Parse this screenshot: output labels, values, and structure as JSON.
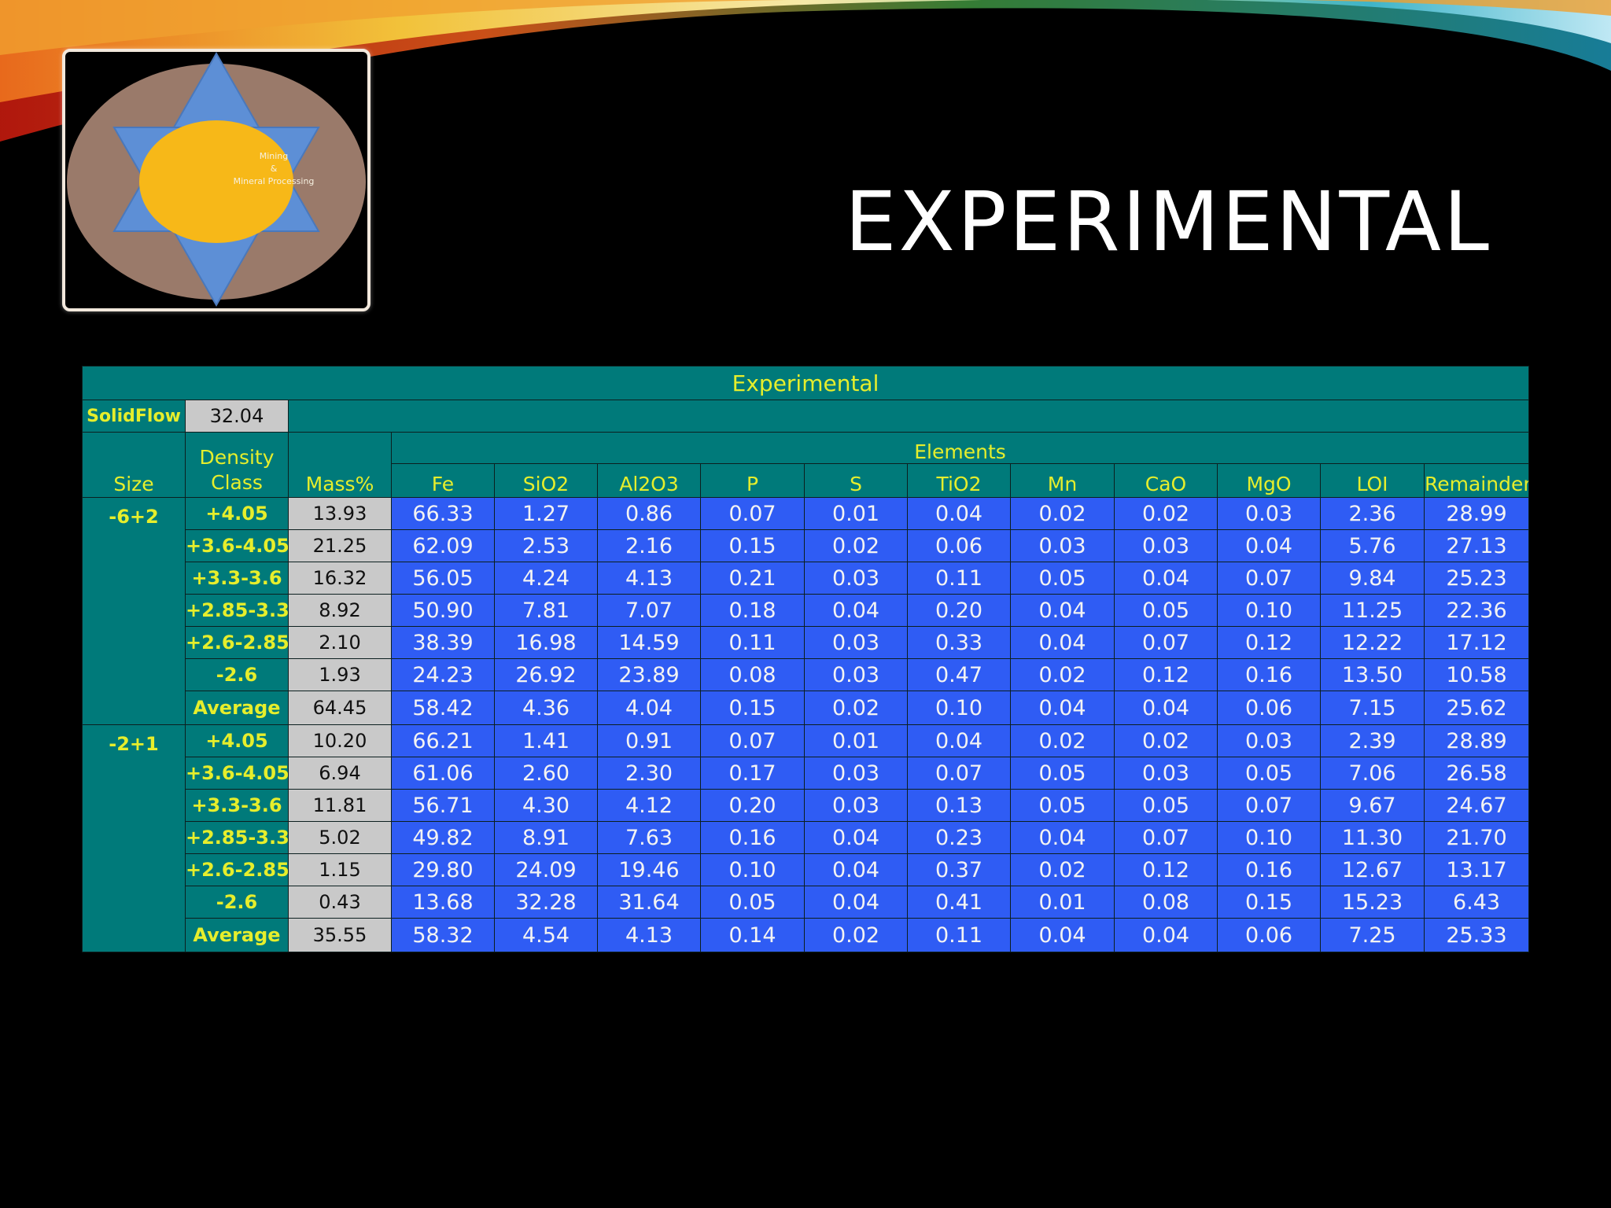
{
  "slide": {
    "title": "EXPERIMENTAL"
  },
  "logo": {
    "text_line1": "Mining",
    "text_line2": "&",
    "text_line3": "Mineral Processing"
  },
  "colors": {
    "teal": "#007a7a",
    "header_text": "#e6ee2c",
    "blue_cells": "#2f5cf4",
    "mass_cells": "#c9c9c9"
  },
  "table": {
    "title": "Experimental",
    "solid_flow_label": "SolidFlow",
    "solid_flow_value": "32.04",
    "headers": {
      "size": "Size",
      "density_line1": "Density",
      "density_line2": "Class",
      "mass": "Mass%",
      "elements": "Elements",
      "columns": [
        "Fe",
        "SiO2",
        "Al2O3",
        "P",
        "S",
        "TiO2",
        "Mn",
        "CaO",
        "MgO",
        "LOI",
        "Remainder"
      ]
    },
    "groups": [
      {
        "size": "-6+2",
        "rows": [
          {
            "density": "+4.05",
            "mass": "13.93",
            "values": [
              "66.33",
              "1.27",
              "0.86",
              "0.07",
              "0.01",
              "0.04",
              "0.02",
              "0.02",
              "0.03",
              "2.36",
              "28.99"
            ]
          },
          {
            "density": "+3.6-4.05",
            "mass": "21.25",
            "values": [
              "62.09",
              "2.53",
              "2.16",
              "0.15",
              "0.02",
              "0.06",
              "0.03",
              "0.03",
              "0.04",
              "5.76",
              "27.13"
            ]
          },
          {
            "density": "+3.3-3.6",
            "mass": "16.32",
            "values": [
              "56.05",
              "4.24",
              "4.13",
              "0.21",
              "0.03",
              "0.11",
              "0.05",
              "0.04",
              "0.07",
              "9.84",
              "25.23"
            ]
          },
          {
            "density": "+2.85-3.3",
            "mass": "8.92",
            "values": [
              "50.90",
              "7.81",
              "7.07",
              "0.18",
              "0.04",
              "0.20",
              "0.04",
              "0.05",
              "0.10",
              "11.25",
              "22.36"
            ]
          },
          {
            "density": "+2.6-2.85",
            "mass": "2.10",
            "values": [
              "38.39",
              "16.98",
              "14.59",
              "0.11",
              "0.03",
              "0.33",
              "0.04",
              "0.07",
              "0.12",
              "12.22",
              "17.12"
            ]
          },
          {
            "density": "-2.6",
            "mass": "1.93",
            "values": [
              "24.23",
              "26.92",
              "23.89",
              "0.08",
              "0.03",
              "0.47",
              "0.02",
              "0.12",
              "0.16",
              "13.50",
              "10.58"
            ]
          },
          {
            "density": "Average",
            "mass": "64.45",
            "values": [
              "58.42",
              "4.36",
              "4.04",
              "0.15",
              "0.02",
              "0.10",
              "0.04",
              "0.04",
              "0.06",
              "7.15",
              "25.62"
            ]
          }
        ]
      },
      {
        "size": "-2+1",
        "rows": [
          {
            "density": "+4.05",
            "mass": "10.20",
            "values": [
              "66.21",
              "1.41",
              "0.91",
              "0.07",
              "0.01",
              "0.04",
              "0.02",
              "0.02",
              "0.03",
              "2.39",
              "28.89"
            ]
          },
          {
            "density": "+3.6-4.05",
            "mass": "6.94",
            "values": [
              "61.06",
              "2.60",
              "2.30",
              "0.17",
              "0.03",
              "0.07",
              "0.05",
              "0.03",
              "0.05",
              "7.06",
              "26.58"
            ]
          },
          {
            "density": "+3.3-3.6",
            "mass": "11.81",
            "values": [
              "56.71",
              "4.30",
              "4.12",
              "0.20",
              "0.03",
              "0.13",
              "0.05",
              "0.05",
              "0.07",
              "9.67",
              "24.67"
            ]
          },
          {
            "density": "+2.85-3.3",
            "mass": "5.02",
            "values": [
              "49.82",
              "8.91",
              "7.63",
              "0.16",
              "0.04",
              "0.23",
              "0.04",
              "0.07",
              "0.10",
              "11.30",
              "21.70"
            ]
          },
          {
            "density": "+2.6-2.85",
            "mass": "1.15",
            "values": [
              "29.80",
              "24.09",
              "19.46",
              "0.10",
              "0.04",
              "0.37",
              "0.02",
              "0.12",
              "0.16",
              "12.67",
              "13.17"
            ]
          },
          {
            "density": "-2.6",
            "mass": "0.43",
            "values": [
              "13.68",
              "32.28",
              "31.64",
              "0.05",
              "0.04",
              "0.41",
              "0.01",
              "0.08",
              "0.15",
              "15.23",
              "6.43"
            ]
          },
          {
            "density": "Average",
            "mass": "35.55",
            "values": [
              "58.32",
              "4.54",
              "4.13",
              "0.14",
              "0.02",
              "0.11",
              "0.04",
              "0.04",
              "0.06",
              "7.25",
              "25.33"
            ]
          }
        ]
      }
    ]
  }
}
